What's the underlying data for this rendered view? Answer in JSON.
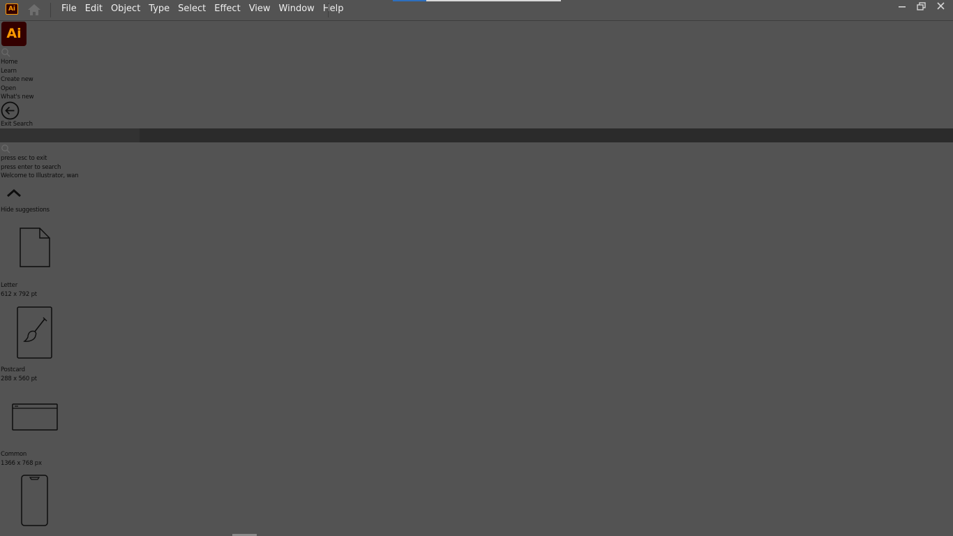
{
  "titlebar": {
    "app_badge": "Ai",
    "menu": [
      "File",
      "Edit",
      "Object",
      "Type",
      "Select",
      "Effect",
      "View",
      "Window",
      "Help"
    ],
    "progress_fraction": 0.2,
    "icons": [
      "home-icon",
      "minimize-icon",
      "restore-icon",
      "close-icon"
    ]
  },
  "sidebar": {
    "logo": "Ai",
    "nav": [
      "Home",
      "Learn",
      "Create new",
      "Open",
      "What's new"
    ],
    "exit_search_label": "Exit Search"
  },
  "search": {
    "hint_exit": "press esc to exit",
    "hint_enter": "press enter to search",
    "welcome": "Welcome to Illustrator, wan"
  },
  "suggestions": {
    "toggle_label": "Hide suggestions",
    "presets": [
      {
        "name": "Letter",
        "size": "612 x 792 pt",
        "icon": "document-icon"
      },
      {
        "name": "Postcard",
        "size": "288 x 560 pt",
        "icon": "paintbrush-icon"
      },
      {
        "name": "Common",
        "size": "1366 x 768 px",
        "icon": "browser-window-icon"
      },
      {
        "name": "",
        "size": "",
        "icon": "mobile-phone-icon"
      }
    ]
  },
  "colors": {
    "background": "#535353",
    "brand_dark": "#330000",
    "brand_accent": "#ff9a00",
    "progress": "#2d6fbd"
  }
}
